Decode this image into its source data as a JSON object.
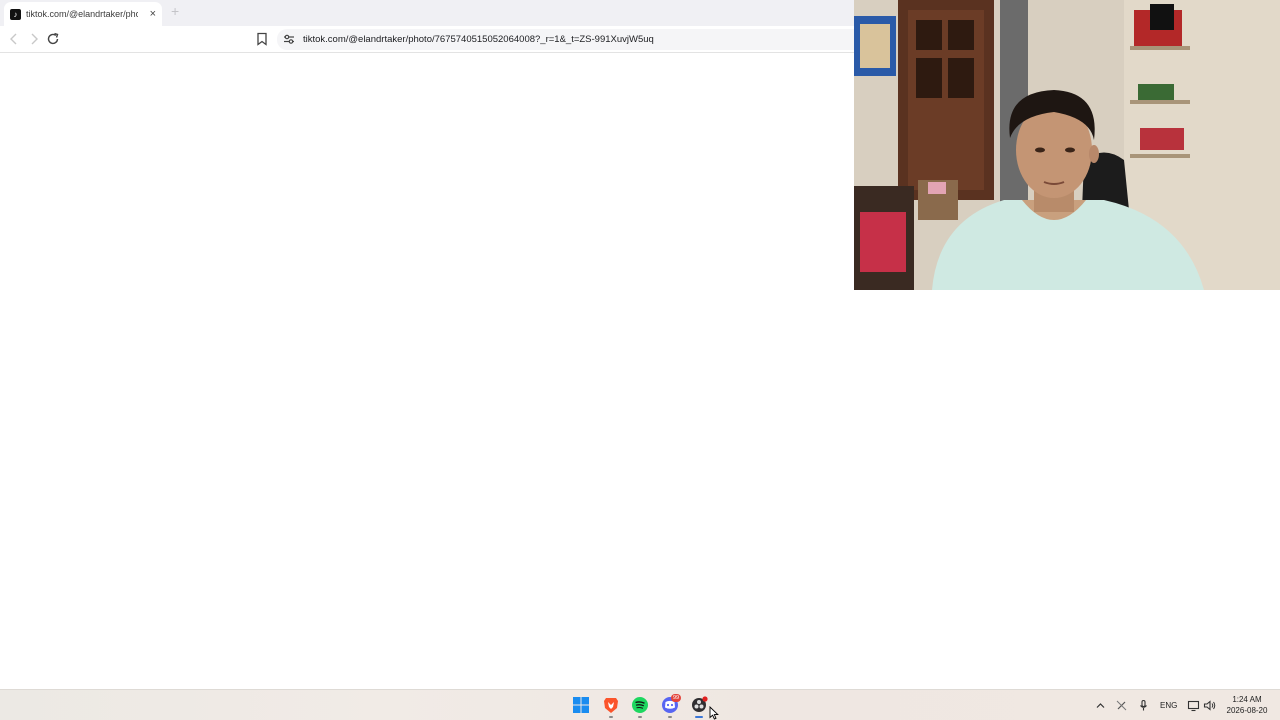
{
  "browser": {
    "tab": {
      "favicon": "tiktok-icon",
      "title": "tiktok.com/@elandrtaker/photo",
      "close": "×"
    },
    "new_tab": "+",
    "url": "tiktok.com/@elandrtaker/photo/7675740515052064008?_r=1&_t=ZS-991XuvjW5uq"
  },
  "webcam": {
    "description_icon": "webcam-feed"
  },
  "taskbar": {
    "apps": [
      "start-icon",
      "brave-icon",
      "spotify-icon",
      "discord-icon",
      "obs-icon"
    ],
    "discord_badge": "99",
    "tray": {
      "language": "ENG",
      "time": "1:24 AM",
      "date": "2026-08-20"
    }
  },
  "colors": {
    "taskbar_accent": "#3c76d6",
    "brave": "#fb542b",
    "spotify": "#1ed760",
    "discord": "#5865f2"
  }
}
